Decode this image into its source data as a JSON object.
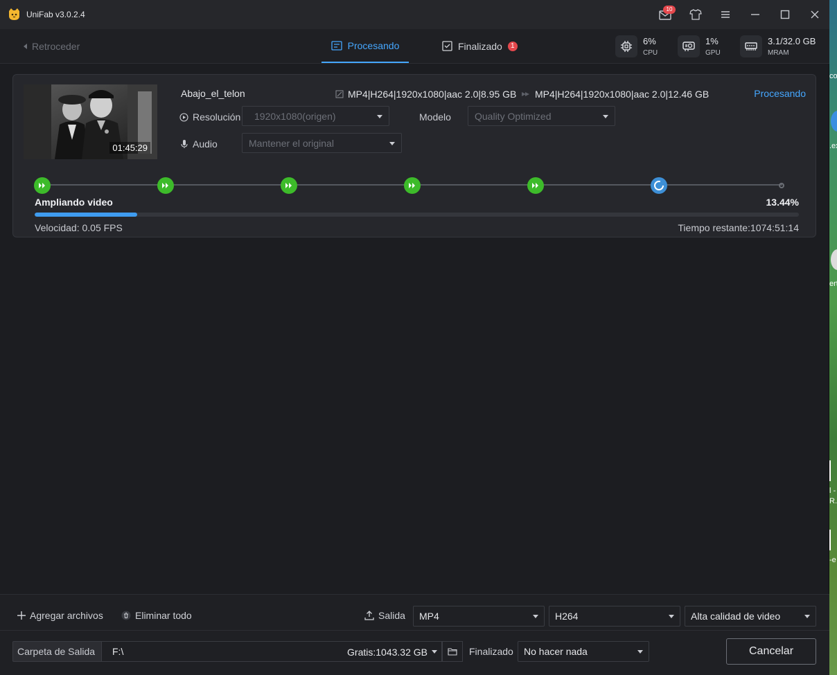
{
  "app": {
    "title": "UniFab v3.0.2.4",
    "notification_count": "10"
  },
  "nav": {
    "back_label": "Retroceder",
    "tabs": [
      {
        "label": "Procesando",
        "active": true
      },
      {
        "label": "Finalizado",
        "badge": "1"
      }
    ],
    "stats": [
      {
        "value": "6%",
        "label": "CPU"
      },
      {
        "value": "1%",
        "label": "GPU"
      },
      {
        "value": "3.1/32.0 GB",
        "label": "MRAM"
      }
    ]
  },
  "task": {
    "duration": "01:45:29",
    "file_name": "Abajo_el_telon",
    "source_format": "MP4|H264|1920x1080|aac 2.0|8.95 GB",
    "target_format": "MP4|H264|1920x1080|aac 2.0|12.46 GB",
    "status": "Procesando",
    "resolution": {
      "label": "Resolución",
      "value": "1920x1080(origen)"
    },
    "model": {
      "label": "Modelo",
      "value": "Quality Optimized"
    },
    "audio": {
      "label": "Audio",
      "value": "Mantener el original"
    },
    "steps_total": 7,
    "steps_done": 5,
    "stage": "Ampliando video",
    "progress": "13.44%",
    "progress_fraction": 0.1344,
    "speed": "Velocidad: 0.05  FPS",
    "remaining": "Tiempo restante:1074:51:14"
  },
  "bottom": {
    "add_files": "Agregar archivos",
    "remove_all": "Eliminar todo",
    "output_label": "Salida",
    "container": "MP4",
    "codec": "H264",
    "quality": "Alta calidad de video",
    "output_folder_label": "Carpeta de Salida",
    "output_path": "F:\\",
    "free_space": "Gratis:1043.32 GB",
    "finished_label": "Finalizado",
    "finished_action": "No hacer nada",
    "cancel": "Cancelar"
  },
  "desktop": {
    "fragments": [
      "col",
      ".ex",
      "ert",
      "l -",
      "R.",
      "-e"
    ]
  },
  "colors": {
    "accent": "#45a7ff",
    "step_done": "#3dbb2a",
    "badge": "#e5484d"
  }
}
